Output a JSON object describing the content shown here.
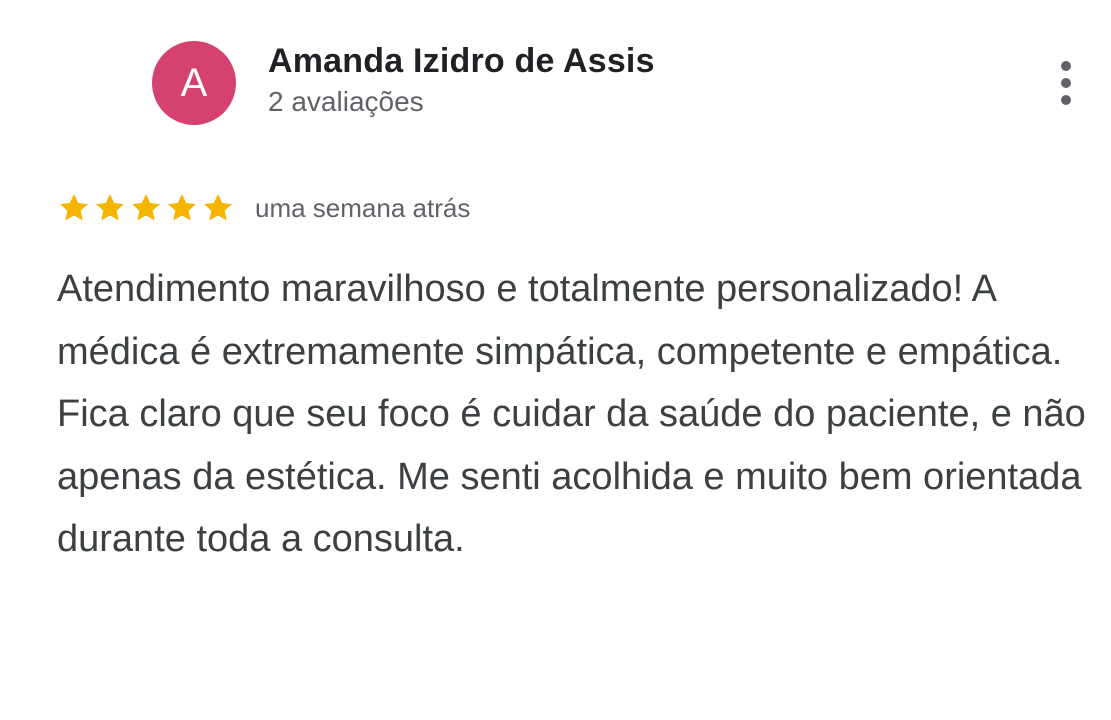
{
  "review": {
    "avatar_letter": "A",
    "avatar_color": "#d6426f",
    "reviewer_name": "Amanda Izidro de Assis",
    "reviewer_meta": "2 avaliações",
    "more_icon": "more-vert-icon",
    "rating": 5,
    "rating_max": 5,
    "star_color": "#f4b400",
    "date": "uma semana atrás",
    "text": "Atendimento maravilhoso e totalmente personalizado! A médica é extremamente simpática, competente e empática. Fica claro que seu foco é cuidar da saúde do paciente, e não apenas da estética. Me senti acolhida e muito bem orientada durante toda a consulta."
  }
}
